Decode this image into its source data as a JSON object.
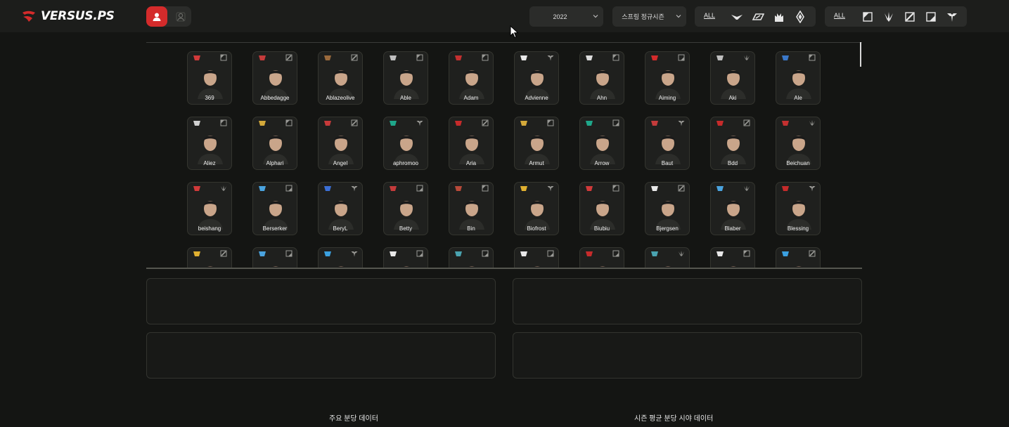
{
  "app": {
    "logo_text": "VERSUS.PS",
    "brand_color": "#d42b2b",
    "mode_toggle": {
      "active": "player",
      "inactive": "team"
    }
  },
  "filters": {
    "year": {
      "value": "2022"
    },
    "season": {
      "value": "스프링 정규시즌"
    },
    "league_filter": {
      "all_label": "ALL",
      "icons": [
        "lec-icon",
        "lcs-icon",
        "lck-icon",
        "lpl-icon"
      ]
    },
    "position_filter": {
      "all_label": "ALL",
      "icons": [
        "top-icon",
        "jungle-icon",
        "mid-icon",
        "bot-icon",
        "support-icon"
      ]
    }
  },
  "players": [
    {
      "name": "369",
      "team_color": "#d13a3a",
      "position": "top"
    },
    {
      "name": "Abbedagge",
      "team_color": "#c43b3b",
      "position": "mid"
    },
    {
      "name": "Ablazeolive",
      "team_color": "#9b6a3c",
      "position": "mid"
    },
    {
      "name": "Able",
      "team_color": "#bfbfbf",
      "position": "top"
    },
    {
      "name": "Adam",
      "team_color": "#c43030",
      "position": "top"
    },
    {
      "name": "Advienne",
      "team_color": "#e8e8e8",
      "position": "support"
    },
    {
      "name": "Ahn",
      "team_color": "#dcdcdc",
      "position": "top"
    },
    {
      "name": "Aiming",
      "team_color": "#d32b2b",
      "position": "bot"
    },
    {
      "name": "Aki",
      "team_color": "#bfbfbf",
      "position": "jungle"
    },
    {
      "name": "Ale",
      "team_color": "#3b78c9",
      "position": "top"
    },
    {
      "name": "Aliez",
      "team_color": "#d0d0d0",
      "position": "top"
    },
    {
      "name": "Alphari",
      "team_color": "#d4a93a",
      "position": "top"
    },
    {
      "name": "Angel",
      "team_color": "#c73a3a",
      "position": "mid"
    },
    {
      "name": "aphromoo",
      "team_color": "#1fa78a",
      "position": "support"
    },
    {
      "name": "Aria",
      "team_color": "#c62b2b",
      "position": "mid"
    },
    {
      "name": "Armut",
      "team_color": "#d4a93a",
      "position": "top"
    },
    {
      "name": "Arrow",
      "team_color": "#1fa78a",
      "position": "bot"
    },
    {
      "name": "Baut",
      "team_color": "#c43b3b",
      "position": "support"
    },
    {
      "name": "Bdd",
      "team_color": "#c62b2b",
      "position": "mid"
    },
    {
      "name": "Beichuan",
      "team_color": "#c43030",
      "position": "jungle"
    },
    {
      "name": "beishang",
      "team_color": "#d13a3a",
      "position": "jungle"
    },
    {
      "name": "Berserker",
      "team_color": "#4aa3df",
      "position": "bot"
    },
    {
      "name": "BeryL",
      "team_color": "#3b6fd6",
      "position": "support"
    },
    {
      "name": "Betty",
      "team_color": "#c43b3b",
      "position": "bot"
    },
    {
      "name": "Bin",
      "team_color": "#b84a3a",
      "position": "top"
    },
    {
      "name": "Biofrost",
      "team_color": "#e0b030",
      "position": "support"
    },
    {
      "name": "Biubiu",
      "team_color": "#d13a3a",
      "position": "top"
    },
    {
      "name": "Bjergsen",
      "team_color": "#e8e8e8",
      "position": "mid"
    },
    {
      "name": "Blaber",
      "team_color": "#4aa3df",
      "position": "jungle"
    },
    {
      "name": "Blessing",
      "team_color": "#c62b2b",
      "position": "support"
    },
    {
      "name": "",
      "team_color": "#e0b030",
      "position": "mid"
    },
    {
      "name": "",
      "team_color": "#4aa3df",
      "position": "bot"
    },
    {
      "name": "",
      "team_color": "#3ba0e0",
      "position": "support"
    },
    {
      "name": "",
      "team_color": "#e8e8e8",
      "position": "bot"
    },
    {
      "name": "",
      "team_color": "#4aa3b0",
      "position": "bot"
    },
    {
      "name": "",
      "team_color": "#e8e8e8",
      "position": "bot"
    },
    {
      "name": "",
      "team_color": "#c62b2b",
      "position": "bot"
    },
    {
      "name": "",
      "team_color": "#4aa3b0",
      "position": "jungle"
    },
    {
      "name": "",
      "team_color": "#e8e8e8",
      "position": "top"
    },
    {
      "name": "",
      "team_color": "#3ba0e0",
      "position": "mid"
    }
  ],
  "sections": {
    "left_title": "주요 분당 데이터",
    "right_title": "시즌 평균 분당 시야 데이터"
  }
}
